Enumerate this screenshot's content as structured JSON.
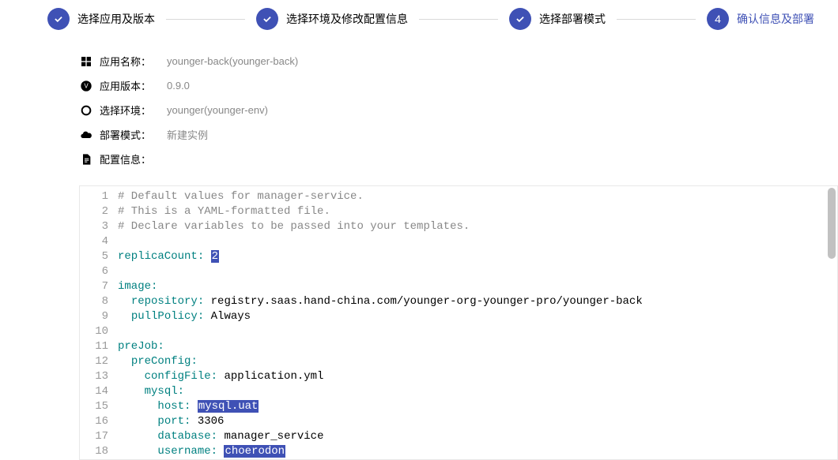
{
  "stepper": {
    "steps": [
      {
        "label": "选择应用及版本",
        "done": true
      },
      {
        "label": "选择环境及修改配置信息",
        "done": true
      },
      {
        "label": "选择部署模式",
        "done": true
      },
      {
        "label": "确认信息及部署",
        "done": false,
        "num": "4",
        "active": true
      }
    ]
  },
  "info": {
    "appName": {
      "label": "应用名称：",
      "value": "younger-back(younger-back)"
    },
    "appVersion": {
      "label": "应用版本：",
      "value": "0.9.0"
    },
    "env": {
      "label": "选择环境：",
      "value": "younger(younger-env)"
    },
    "deployMode": {
      "label": "部署模式：",
      "value": "新建实例"
    },
    "config": {
      "label": "配置信息："
    }
  },
  "codeLines": [
    {
      "n": 1,
      "type": "comment",
      "text": "# Default values for manager-service."
    },
    {
      "n": 2,
      "type": "comment",
      "text": "# This is a YAML-formatted file."
    },
    {
      "n": 3,
      "type": "comment",
      "text": "# Declare variables to be passed into your templates."
    },
    {
      "n": 4,
      "type": "blank",
      "text": ""
    },
    {
      "n": 5,
      "type": "kv",
      "indent": 0,
      "key": "replicaCount",
      "value": "2",
      "hl": true
    },
    {
      "n": 6,
      "type": "blank",
      "text": ""
    },
    {
      "n": 7,
      "type": "key",
      "indent": 0,
      "key": "image"
    },
    {
      "n": 8,
      "type": "kv",
      "indent": 1,
      "key": "repository",
      "value": "registry.saas.hand-china.com/younger-org-younger-pro/younger-back"
    },
    {
      "n": 9,
      "type": "kv",
      "indent": 1,
      "key": "pullPolicy",
      "value": "Always"
    },
    {
      "n": 10,
      "type": "blank",
      "text": ""
    },
    {
      "n": 11,
      "type": "key",
      "indent": 0,
      "key": "preJob"
    },
    {
      "n": 12,
      "type": "key",
      "indent": 1,
      "key": "preConfig"
    },
    {
      "n": 13,
      "type": "kv",
      "indent": 2,
      "key": "configFile",
      "value": "application.yml"
    },
    {
      "n": 14,
      "type": "key",
      "indent": 2,
      "key": "mysql"
    },
    {
      "n": 15,
      "type": "kv",
      "indent": 3,
      "key": "host",
      "value": "mysql.uat",
      "hl": true
    },
    {
      "n": 16,
      "type": "kv",
      "indent": 3,
      "key": "port",
      "value": "3306"
    },
    {
      "n": 17,
      "type": "kv",
      "indent": 3,
      "key": "database",
      "value": "manager_service"
    },
    {
      "n": 18,
      "type": "kv",
      "indent": 3,
      "key": "username",
      "value": "choerodon",
      "hl": true
    }
  ]
}
